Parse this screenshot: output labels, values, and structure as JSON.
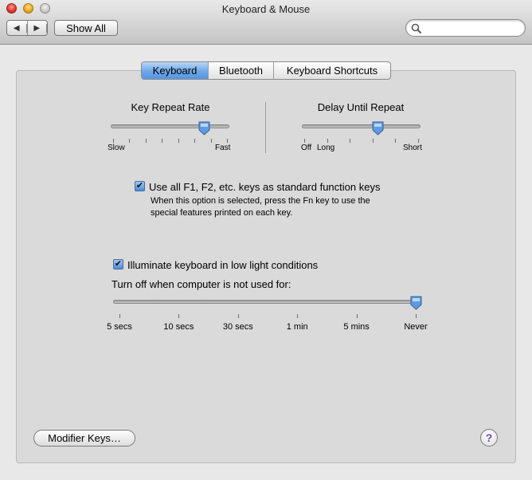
{
  "window": {
    "title": "Keyboard & Mouse"
  },
  "toolbar": {
    "back_icon": "◀",
    "forward_icon": "▶",
    "show_all_label": "Show All",
    "search_placeholder": ""
  },
  "tabs": [
    {
      "label": "Keyboard",
      "selected": true
    },
    {
      "label": "Bluetooth",
      "selected": false
    },
    {
      "label": "Keyboard Shortcuts",
      "selected": false
    }
  ],
  "key_repeat": {
    "label": "Key Repeat Rate",
    "min_label": "Slow",
    "max_label": "Fast",
    "value_fraction": 0.8
  },
  "delay_repeat": {
    "label": "Delay Until Repeat",
    "left_label": "Off",
    "min_label": "Long",
    "max_label": "Short",
    "value_fraction": 0.65
  },
  "fn_keys": {
    "checked": true,
    "label": "Use all F1, F2, etc. keys as standard function keys",
    "description_line1": "When this option is selected, press the Fn key to use the",
    "description_line2": "special features printed on each key."
  },
  "illuminate": {
    "checked": true,
    "label": "Illuminate keyboard in low light conditions",
    "turn_off_label": "Turn off when computer is not used for:",
    "ticks": [
      "5 secs",
      "10 secs",
      "30 secs",
      "1 min",
      "5 mins",
      "Never"
    ],
    "selected": "Never"
  },
  "footer": {
    "modifier_keys_label": "Modifier Keys…",
    "help_label": "?"
  },
  "colors": {
    "selected_tab": "#5d9ae2",
    "help_glyph": "#7a3fb5"
  }
}
